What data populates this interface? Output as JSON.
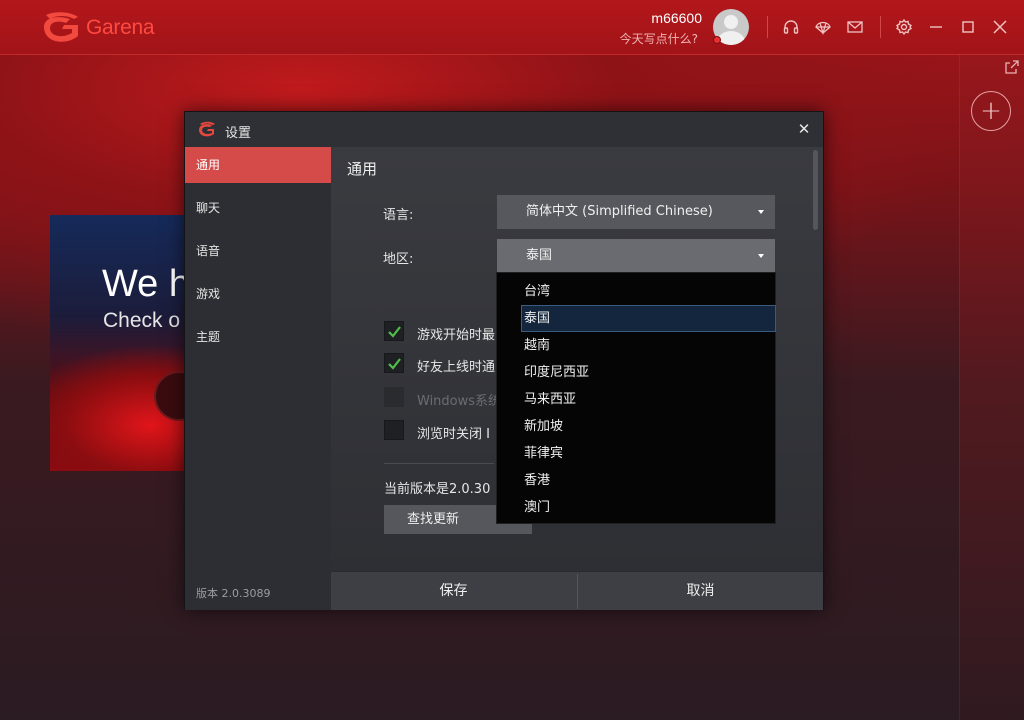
{
  "app": {
    "brand": "Garena",
    "user_name": "m66600",
    "user_status": "今天写点什么?"
  },
  "banner": {
    "title": "We h",
    "subtitle": "Check o"
  },
  "dialog": {
    "title": "设置",
    "nav": [
      {
        "label": "通用",
        "active": true
      },
      {
        "label": "聊天",
        "active": false
      },
      {
        "label": "语音",
        "active": false
      },
      {
        "label": "游戏",
        "active": false
      },
      {
        "label": "主题",
        "active": false
      }
    ],
    "version_footer": "版本 2.0.3089",
    "section_title": "通用",
    "language_label": "语言:",
    "language_value": "简体中文 (Simplified Chinese)",
    "region_label": "地区:",
    "region_value": "泰国",
    "checkboxes": [
      {
        "label": "游戏开始时最",
        "checked": true,
        "disabled": false
      },
      {
        "label": "好友上线时通",
        "checked": true,
        "disabled": false
      },
      {
        "label": "Windows系统",
        "checked": false,
        "disabled": true
      },
      {
        "label": "浏览时关闭 I",
        "checked": false,
        "disabled": false
      }
    ],
    "version_text": "当前版本是2.0.30",
    "check_update_label": "查找更新",
    "save_label": "保存",
    "cancel_label": "取消"
  },
  "region_dropdown": {
    "options": [
      "台湾",
      "泰国",
      "越南",
      "印度尼西亚",
      "马来西亚",
      "新加坡",
      "菲律宾",
      "香港",
      "澳门"
    ],
    "selected": "泰国"
  },
  "colors": {
    "accent": "#d44b4a",
    "titlebar": "#a11418",
    "dialog_bg": "#2b2c31"
  }
}
